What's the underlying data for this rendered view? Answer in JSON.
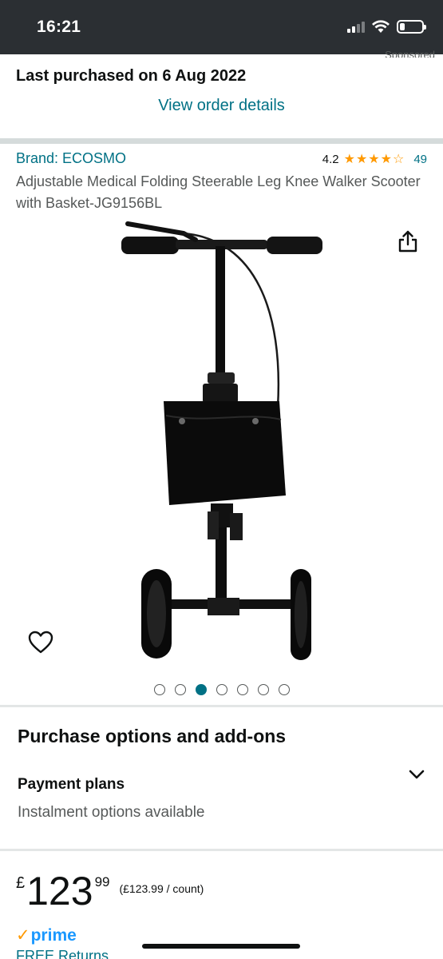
{
  "status_bar": {
    "time": "16:21",
    "signal_bars_active": 2
  },
  "sponsored": {
    "label": "Sponsored"
  },
  "order": {
    "last_purchased": "Last purchased on 6 Aug 2022",
    "view_details": "View order details"
  },
  "product": {
    "brand": "Brand: ECOSMO",
    "rating_value": "4.2",
    "rating_stars": 4.2,
    "rating_count": "49",
    "title": "Adjustable Medical Folding Steerable Leg Knee Walker Scooter with Basket-JG9156BL"
  },
  "icons": {
    "share": "share-icon",
    "wishlist": "heart-icon",
    "chevron": "chevron-down-icon",
    "prime_check": "✓"
  },
  "carousel": {
    "total": 7,
    "active_index": 2
  },
  "purchase": {
    "section_title": "Purchase options and add-ons",
    "payment_title": "Payment plans",
    "payment_subtitle": "Instalment options available"
  },
  "price": {
    "symbol": "£",
    "whole": "123",
    "fraction": "99",
    "unit": "(£123.99 / count)"
  },
  "prime": {
    "label": "prime"
  },
  "returns": {
    "label": "FREE Returns"
  },
  "colors": {
    "link": "#007185",
    "star": "#ff9900",
    "prime_blue": "#1a98ff",
    "status_bar": "#2b2f33"
  }
}
